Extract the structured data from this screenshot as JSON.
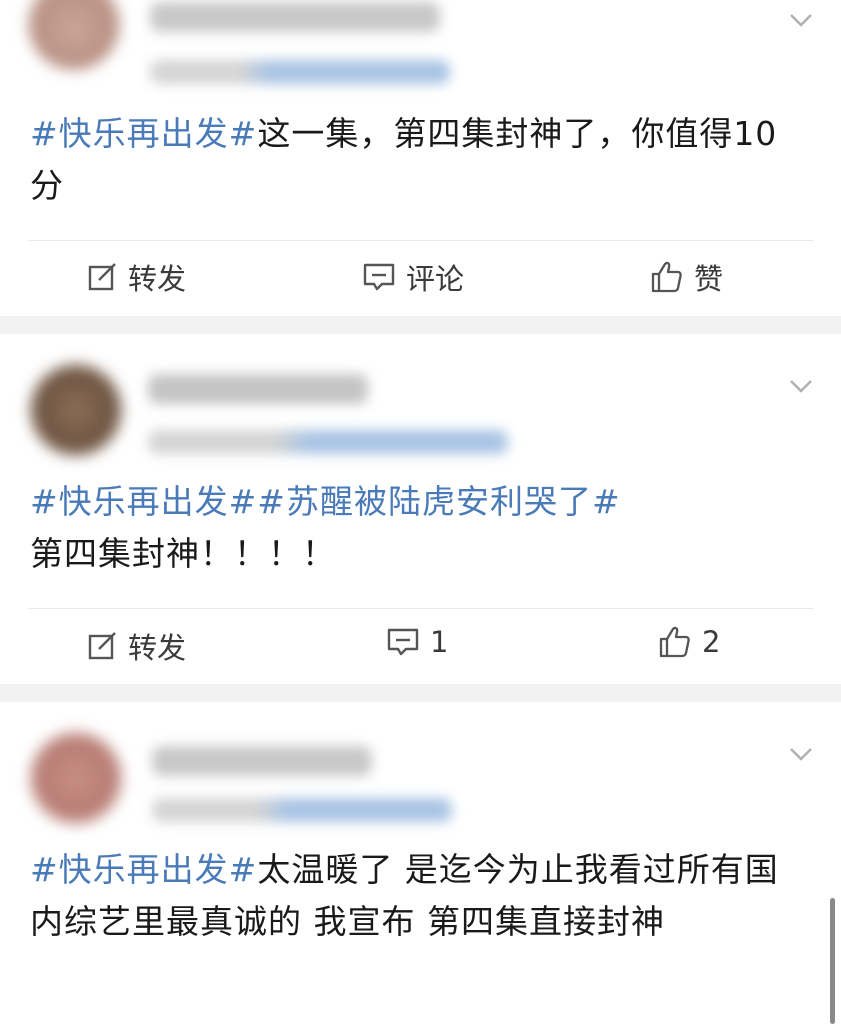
{
  "posts": [
    {
      "text_topic": "#快乐再出发#",
      "text_body": "这一集，第四集封神了，你值得10分",
      "actions": {
        "repost": "转发",
        "comment": "评论",
        "like": "赞"
      }
    },
    {
      "text_topic": "#快乐再出发##苏醒被陆虎安利哭了#",
      "text_body": "第四集封神！！！！",
      "actions": {
        "repost": "转发",
        "comment": "1",
        "like": "2"
      }
    },
    {
      "text_topic": "#快乐再出发#",
      "text_body": "太温暖了 是迄今为止我看过所有国内综艺里最真诚的 我宣布 第四集直接封神"
    }
  ],
  "icons": {
    "repost": "edit-square-icon",
    "comment": "comment-bubble-icon",
    "like": "thumbs-up-icon",
    "more": "chevron-down-icon"
  },
  "colors": {
    "topic": "#4a7ab8",
    "text": "#1a1a1a",
    "background": "#f2f2f2"
  }
}
